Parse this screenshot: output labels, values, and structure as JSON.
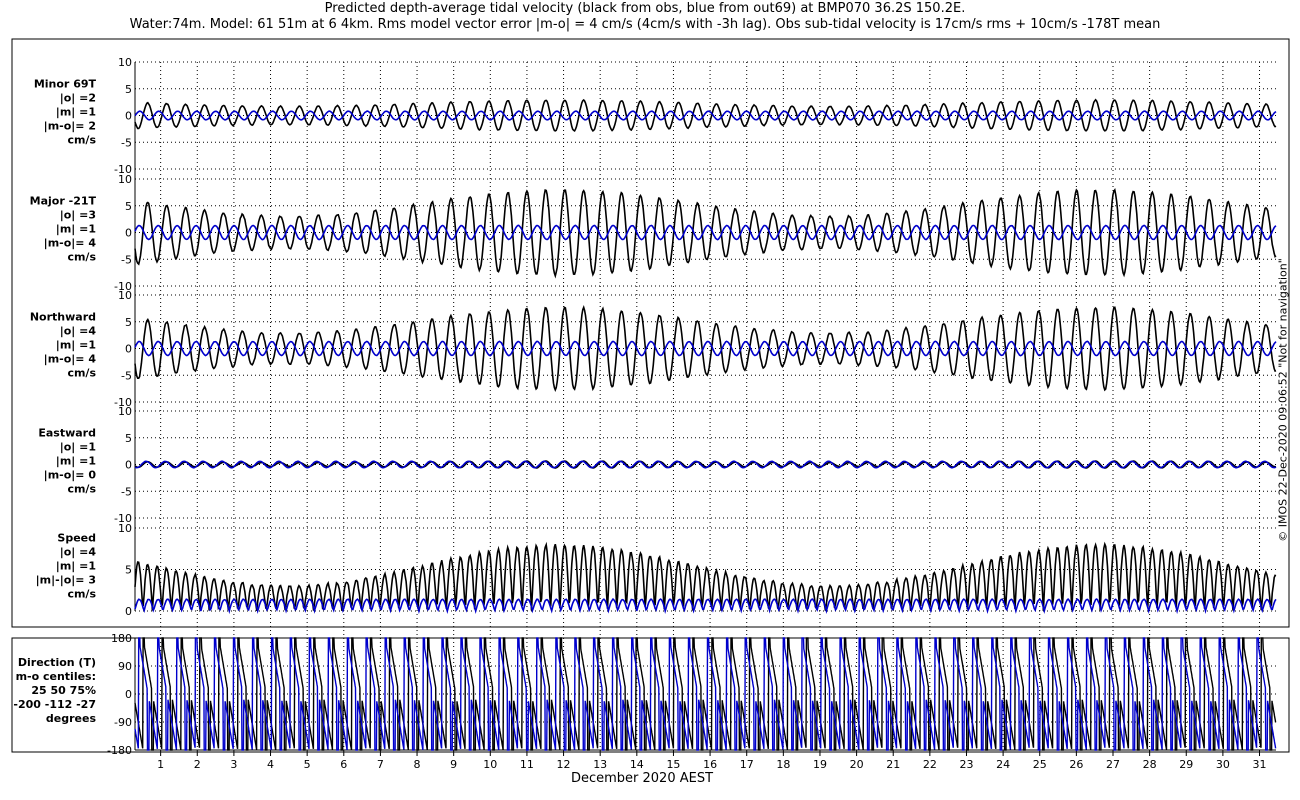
{
  "title_line1": "Predicted depth-average tidal velocity (black from obs, blue from out69) at BMP070 36.2S 150.2E.",
  "title_line2": "Water:74m. Model: 61 51m at 6 4km. Rms model vector error |m-o| = 4 cm/s (4cm/s with -3h lag). Obs sub-tidal velocity is 17cm/s rms + 10cm/s -178T mean",
  "watermark": "© IMOS 22-Dec-2020 09:06:52  \"Not for navigation\"",
  "colors": {
    "obs": "#000000",
    "model": "#0000cc",
    "grid": "#000000"
  },
  "chart_data": {
    "type": "line",
    "xlabel": "December 2020 AEST",
    "x_ticks": [
      "1",
      "2",
      "3",
      "4",
      "5",
      "6",
      "7",
      "8",
      "9",
      "10",
      "11",
      "12",
      "13",
      "14",
      "15",
      "16",
      "17",
      "18",
      "19",
      "20",
      "21",
      "22",
      "23",
      "24",
      "25",
      "26",
      "27",
      "28",
      "29",
      "30",
      "31"
    ],
    "xlim": [
      0.3,
      31.45
    ],
    "series_legend": [
      {
        "name": "obs",
        "color": "#000000"
      },
      {
        "name": "out69",
        "color": "#0000cc"
      }
    ],
    "panels": [
      {
        "id": "minor",
        "labels": [
          "Minor 69T",
          "|o| =2",
          "|m| =1",
          "|m-o|= 2",
          "cm/s"
        ],
        "ylim": [
          -10,
          10
        ],
        "yticks": [
          "10",
          "5",
          "0",
          "-5",
          "-10"
        ],
        "obs": {
          "amp": 2.3,
          "amp_mod": 0.25,
          "phase": 0.0,
          "mean": 0
        },
        "model": {
          "amp": 0.8,
          "phase": 2.6,
          "mean": 0
        }
      },
      {
        "id": "major",
        "labels": [
          "Major -21T",
          "|o| =3",
          "|m| =1",
          "|m-o|= 4",
          "cm/s"
        ],
        "ylim": [
          -10,
          10
        ],
        "yticks": [
          "10",
          "5",
          "0",
          "-5",
          "-10"
        ],
        "obs": {
          "amp": 5.5,
          "amp_mod": 0.45,
          "phase": 0.0,
          "mean": 0
        },
        "model": {
          "amp": 1.3,
          "phase": 2.8,
          "mean": 0
        }
      },
      {
        "id": "northward",
        "labels": [
          "Northward",
          "|o| =4",
          "|m| =1",
          "|m-o|= 4",
          "cm/s"
        ],
        "ylim": [
          -10,
          10
        ],
        "yticks": [
          "10",
          "5",
          "0",
          "-5",
          "-10"
        ],
        "obs": {
          "amp": 5.3,
          "amp_mod": 0.45,
          "phase": 0.0,
          "mean": 0
        },
        "model": {
          "amp": 1.3,
          "phase": 2.8,
          "mean": 0
        }
      },
      {
        "id": "eastward",
        "labels": [
          "Eastward",
          "|o| =1",
          "|m| =1",
          "|m-o|= 0",
          "cm/s"
        ],
        "ylim": [
          -10,
          10
        ],
        "yticks": [
          "10",
          "5",
          "0",
          "-5",
          "-10"
        ],
        "obs": {
          "amp": 0.5,
          "amp_mod": 0.3,
          "phase": 0.0,
          "mean": 0
        },
        "model": {
          "amp": 0.6,
          "phase": 0.5,
          "mean": 0
        }
      },
      {
        "id": "speed",
        "labels": [
          "Speed",
          "|o| =4",
          "|m| =1",
          "|m|-|o|= 3",
          "cm/s"
        ],
        "ylim": [
          0,
          10
        ],
        "yticks": [
          "10",
          "5",
          "0"
        ],
        "kind": "speed",
        "obs": {
          "amp": 5.5,
          "amp_mod": 0.45,
          "phase": 0.0
        },
        "model": {
          "amp": 1.4,
          "phase": 2.8
        }
      },
      {
        "id": "direction",
        "labels": [
          "Direction (T)",
          "m-o centiles:",
          "25  50  75%",
          "-200 -112  -27",
          "degrees"
        ],
        "ylim": [
          -180,
          180
        ],
        "yticks": [
          "180",
          "90",
          "0",
          "-90",
          "-180"
        ],
        "kind": "direction",
        "centiles": [
          "25",
          "50",
          "75%"
        ],
        "centile_values": [
          -200,
          -112,
          -27
        ]
      }
    ]
  }
}
